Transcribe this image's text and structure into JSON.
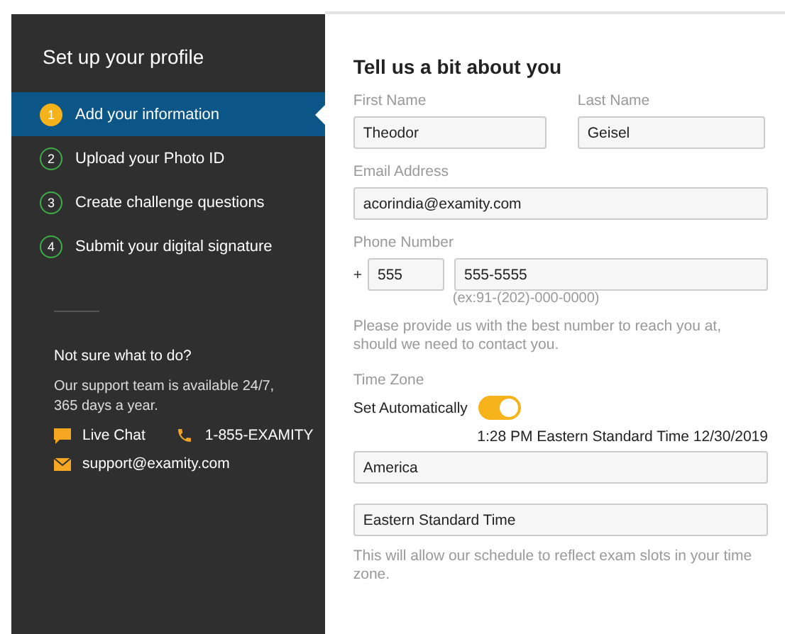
{
  "sidebar": {
    "title": "Set up your profile",
    "steps": [
      {
        "number": "1",
        "label": "Add your information",
        "selected": true
      },
      {
        "number": "2",
        "label": "Upload your Photo ID",
        "selected": false
      },
      {
        "number": "3",
        "label": "Create challenge questions",
        "selected": false
      },
      {
        "number": "4",
        "label": "Submit your digital signature",
        "selected": false
      }
    ],
    "help_title": "Not sure what to do?",
    "help_text": "Our support team is available 24/7, 365 days a year.",
    "live_chat": "Live Chat",
    "phone": "1-855-EXAMITY",
    "email": "support@examity.com"
  },
  "form": {
    "title": "Tell us a bit about you",
    "first_name": {
      "label": "First Name",
      "value": "Theodor"
    },
    "last_name": {
      "label": "Last Name",
      "value": "Geisel"
    },
    "email": {
      "label": "Email Address",
      "value": "acorindia@examity.com"
    },
    "phone": {
      "label": "Phone Number",
      "plus": "+",
      "code": "555",
      "number": "555-5555",
      "hint": "(ex:91-(202)-000-0000)"
    },
    "phone_note": "Please provide us with the best number to reach you at, should we need to contact you.",
    "time_zone": {
      "label": "Time Zone",
      "auto_label": "Set Automatically",
      "auto_on": true,
      "current": "1:28 PM Eastern Standard Time 12/30/2019",
      "region": "America",
      "zone": "Eastern Standard Time"
    },
    "zone_note": "This will allow our schedule to reflect exam slots in your time zone."
  }
}
